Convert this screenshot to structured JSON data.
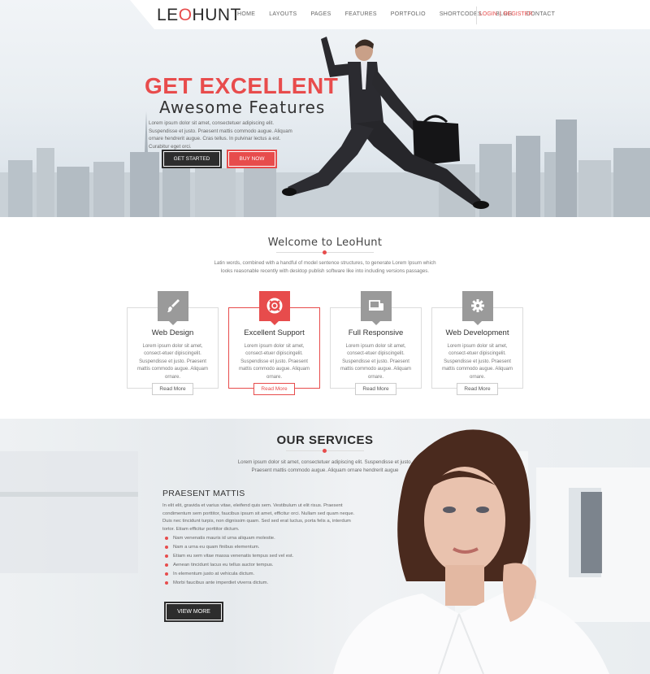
{
  "brand": {
    "logo_pre": "LE",
    "logo_o": "O",
    "logo_post": "HUNT"
  },
  "nav": {
    "items": [
      "HOME",
      "LAYOUTS",
      "PAGES",
      "FEATURES",
      "PORTFOLIO",
      "SHORTCODES",
      "BLOG",
      "CONTACT"
    ],
    "login": "LOGIN",
    "separator": "|",
    "register": "REGISTER"
  },
  "hero": {
    "title": "GET EXCELLENT",
    "subtitle": "Awesome Features",
    "text": "Lorem ipsum dolor sit amet, consectetuer adipiscing elit. Suspendisse et justo. Praesent mattis commodo augue. Aliquam ornare hendrerit augue. Cras tellus. In pulvinar lectus a est. Curabitur eget orci.",
    "btn_start": "GET STARTED",
    "btn_buy": "BUY NOW"
  },
  "welcome": {
    "title": "Welcome to LeoHunt",
    "text": "Latin words, combined with a handful of model sentence structures, to generate Lorem Ipsum which looks reasonable recently with desktop publish software like into including versions passages."
  },
  "features": [
    {
      "title": "Web Design",
      "icon": "brush-icon",
      "text": "Lorem ipsum dolor sit amet, consect-etuer dipiscingelit. Suspendisse et justo. Praesent mattis commodo augue. Aliquam ornare.",
      "button": "Read More"
    },
    {
      "title": "Excellent Support",
      "icon": "lifebuoy-icon",
      "text": "Lorem ipsum dolor sit amet, consect-etuer dipiscingelit. Suspendisse et justo. Praesent mattis commodo augue. Aliquam ornare.",
      "button": "Read More"
    },
    {
      "title": "Full Responsive",
      "icon": "devices-icon",
      "text": "Lorem ipsum dolor sit amet, consect-etuer dipiscingelit. Suspendisse et justo. Praesent mattis commodo augue. Aliquam ornare.",
      "button": "Read More"
    },
    {
      "title": "Web Development",
      "icon": "gear-icon",
      "text": "Lorem ipsum dolor sit amet, consect-etuer dipiscingelit. Suspendisse et justo. Praesent mattis commodo augue. Aliquam ornare.",
      "button": "Read More"
    }
  ],
  "services": {
    "title": "OUR SERVICES",
    "text": "Lorem ipsum dolor sit amet, consectetuer adipiscing elit. Suspendisse et justo. Praesent mattis commodo augue. Aliquam ornare hendrerit augue",
    "pm_title": "PRAESENT MATTIS",
    "pm_text": "In elit elit, gravida et varius vitae, eleifend quis sem. Vestibulum ut elit risus. Praesent condimentum sem porttitor, faucibus ipsum sit amet, efficitur orci. Nullam sed quam neque. Duis nec tincidunt turpis, non dignissim quam. Sed sed erat luctus, porta felis a, interdum tortor. Etiam efficitur porttitor dictum.",
    "list": [
      "Nam venenatis mauris id urna aliquam molestie.",
      "Nam a urna eu quam finibus elementum.",
      "Etiam eu sem vitae massa venenatis tempus sed vel est.",
      "Aenean tincidunt lacus eu tellus auctor tempus.",
      "In elementum justo at vehicula dictum.",
      "Morbi faucibus ante imperdiet viverra dictum."
    ],
    "button": "VIEW MORE"
  },
  "colors": {
    "accent": "#e74c4c",
    "dark": "#2d2d2d",
    "icon_gray": "#9a9a9a"
  }
}
